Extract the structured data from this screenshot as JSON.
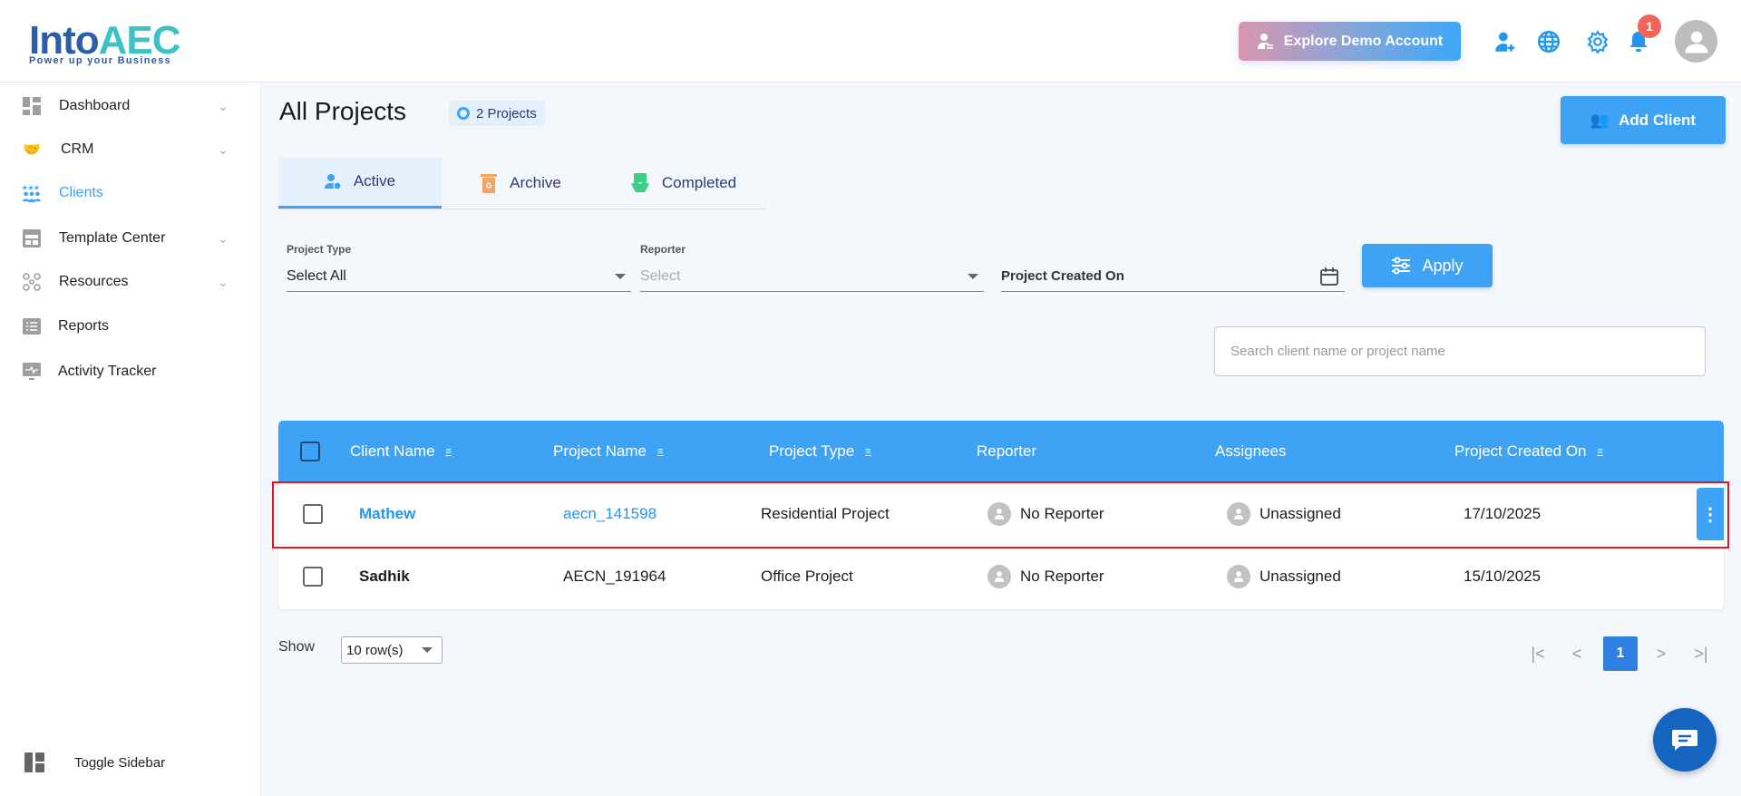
{
  "brand": {
    "name_a": "Into",
    "name_b": "AEC",
    "tagline": "Power up your Business"
  },
  "header": {
    "demo_label": "Explore Demo Account",
    "notification_count": "1"
  },
  "sidebar": {
    "items": [
      {
        "label": "Dashboard",
        "icon": "dashboard-icon",
        "expandable": true
      },
      {
        "label": "CRM",
        "icon": "handshake-icon",
        "expandable": true
      },
      {
        "label": "Clients",
        "icon": "clients-icon",
        "active": true
      },
      {
        "label": "Template Center",
        "icon": "template-icon",
        "expandable": true
      },
      {
        "label": "Resources",
        "icon": "resources-icon",
        "expandable": true
      },
      {
        "label": "Reports",
        "icon": "reports-icon"
      },
      {
        "label": "Activity Tracker",
        "icon": "activity-icon"
      }
    ],
    "toggle_label": "Toggle Sidebar"
  },
  "page": {
    "title": "All Projects",
    "count_label": "2 Projects",
    "add_client_label": "Add Client"
  },
  "tabs": [
    {
      "label": "Active"
    },
    {
      "label": "Archive"
    },
    {
      "label": "Completed"
    }
  ],
  "filters": {
    "project_type_label": "Project Type",
    "project_type_value": "Select All",
    "reporter_label": "Reporter",
    "reporter_placeholder": "Select",
    "created_on_label": "Project Created On",
    "apply_label": "Apply"
  },
  "search": {
    "placeholder": "Search client name or project name"
  },
  "table": {
    "headers": [
      "Client Name",
      "Project Name",
      "Project Type",
      "Reporter",
      "Assignees",
      "Project Created On"
    ],
    "rows": [
      {
        "client": "Mathew",
        "project": "aecn_141598",
        "type": "Residential Project",
        "reporter": "No Reporter",
        "assignees": "Unassigned",
        "created": "17/10/2025"
      },
      {
        "client": "Sadhik",
        "project": "AECN_191964",
        "type": "Office Project",
        "reporter": "No Reporter",
        "assignees": "Unassigned",
        "created": "15/10/2025"
      }
    ]
  },
  "pagination": {
    "show_label": "Show",
    "rows_value": "10 row(s)",
    "current_page": "1"
  },
  "colors": {
    "accent": "#3ea2f5",
    "highlight": "#e8141d",
    "badge": "#f2645a"
  }
}
